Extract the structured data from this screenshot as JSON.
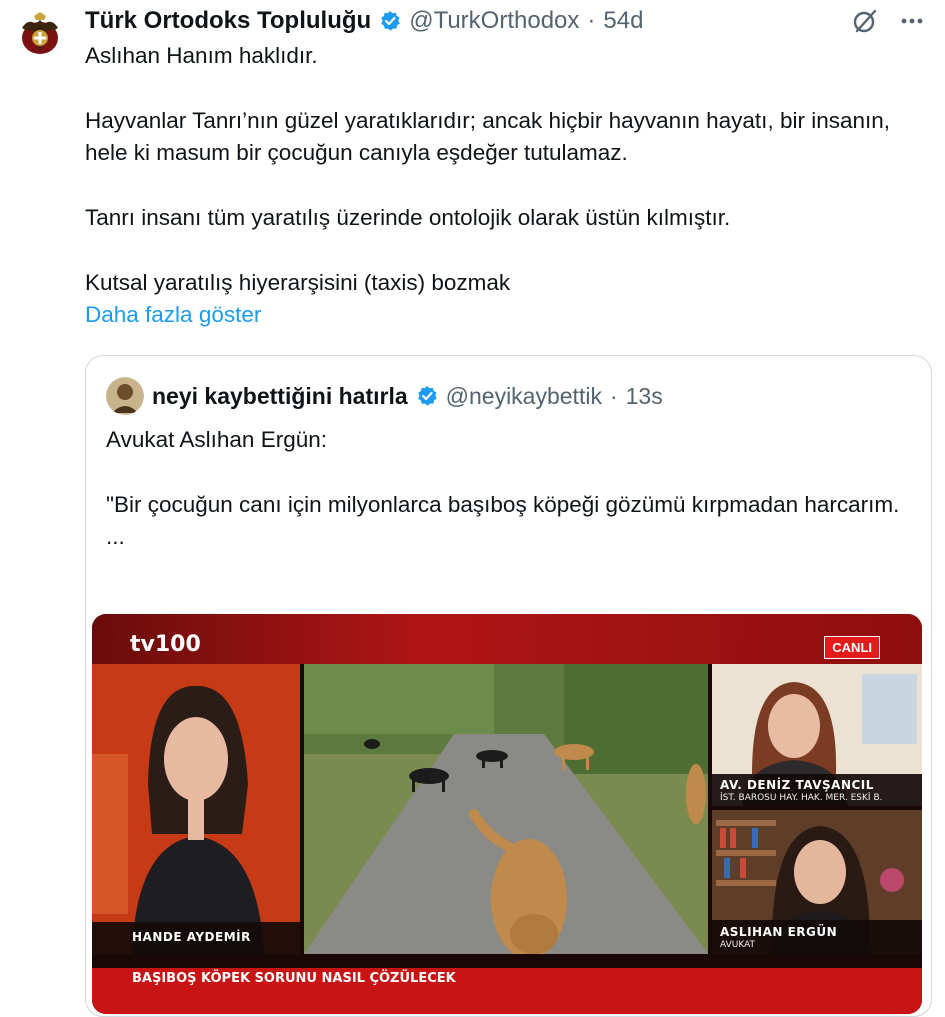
{
  "tweet": {
    "author_name": "Türk Ortodoks Topluluğu",
    "handle": "@TurkOrthodox",
    "separator": "·",
    "time": "54d",
    "lines": [
      "Aslıhan Hanım haklıdır.",
      "Hayvanlar Tanrı’nın güzel yaratıklarıdır; ancak hiçbir hayvanın hayatı, bir insanın, hele ki masum bir çocuğun canıyla eşdeğer tutulamaz.",
      "Tanrı insanı tüm yaratılış üzerinde ontolojik olarak üstün kılmıştır.",
      "Kutsal yaratılış hiyerarşisini (taxis) bozmak"
    ],
    "show_more": "Daha fazla göster"
  },
  "quote": {
    "author_name": "neyi kaybettiğini hatırla",
    "handle": "@neyikaybettik",
    "separator": "·",
    "time": "13s",
    "lines": [
      "Avukat Aslıhan Ergün:",
      "\"Bir çocuğun canı için milyonlarca başıboş köpeği gözümü kırpmadan harcarım.",
      "..."
    ]
  },
  "video": {
    "channel_logo": "tv100",
    "live_badge": "CANLI",
    "presenter_name": "HANDE AYDEMİR",
    "guest1_name": "AV. DENİZ TAVŞANCIL",
    "guest1_title": "İST. BAROSU HAY. HAK. MER. ESKİ B.",
    "guest2_name": "ASLIHAN ERGÜN",
    "guest2_title": "AVUKAT",
    "ticker": "BAŞIBOŞ KÖPEK SORUNU NASIL ÇÖZÜLECEK"
  },
  "colors": {
    "link": "#1d9bf0",
    "verified": "#1d9bf0",
    "muted": "#536471",
    "channel_red": "#c81414"
  },
  "icons": [
    "crest-avatar-icon",
    "verified-badge-icon",
    "grok-icon",
    "more-icon"
  ]
}
